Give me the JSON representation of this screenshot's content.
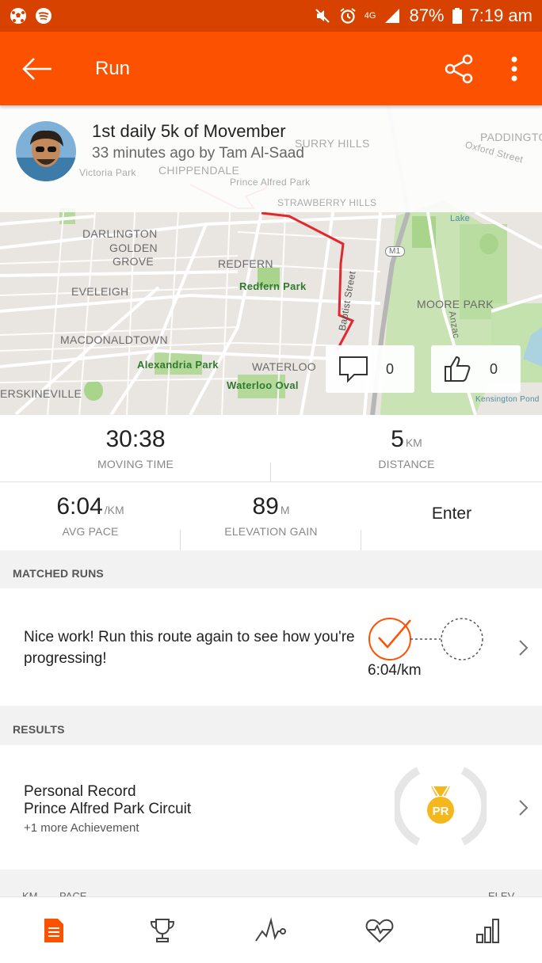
{
  "status_bar": {
    "battery": "87%",
    "time": "7:19 am",
    "network": "4G"
  },
  "app_bar": {
    "title": "Run"
  },
  "activity": {
    "title": "1st daily 5k of Movember",
    "subtitle": "33 minutes ago by Tam Al-Saad",
    "comments_count": "0",
    "kudos_count": "0"
  },
  "map": {
    "labels": [
      "DARLINGTON",
      "GOLDEN",
      "GROVE",
      "EVELEIGH",
      "REDFERN",
      "Redfern Park",
      "Baptist Street",
      "MOORE PARK",
      "MACDONALDTOWN",
      "Alexandria Park",
      "WATERLOO",
      "Waterloo Oval",
      "ERSKINEVILLE",
      "M1",
      "Anzac",
      "Kensington Pond",
      "Victoria Park",
      "CHIPPENDALE",
      "Prince Alfred Park",
      "STRAWBERRY HILLS",
      "SURRY HILLS",
      "PADDINGTON",
      "Oxford Street",
      "Lake"
    ]
  },
  "stats": {
    "moving_time": {
      "value": "30:38",
      "label": "MOVING TIME"
    },
    "distance": {
      "value": "5",
      "unit": "KM",
      "label": "DISTANCE"
    },
    "avg_pace": {
      "value": "6:04",
      "unit": "/KM",
      "label": "AVG PACE"
    },
    "elevation": {
      "value": "89",
      "unit": "M",
      "label": "ELEVATION GAIN"
    },
    "enter_label": "Enter"
  },
  "matched_runs": {
    "heading": "MATCHED RUNS",
    "text": "Nice work! Run this route again to see how you're progressing!",
    "pace": "6:04/km"
  },
  "results": {
    "heading": "RESULTS",
    "line1": "Personal Record",
    "line2": "Prince Alfred Park Circuit",
    "line3": "+1 more Achievement",
    "badge": "PR"
  },
  "splits_peek": {
    "km": "KM",
    "pace": "PACE",
    "elev": "ELEV"
  },
  "colors": {
    "accent": "#fc5200",
    "status": "#d84200",
    "gold": "#f5b81c",
    "route": "#e0282e"
  },
  "bottom_nav": [
    {
      "icon": "feed-icon",
      "active": true
    },
    {
      "icon": "trophy-icon",
      "active": false
    },
    {
      "icon": "activity-graph-icon",
      "active": false
    },
    {
      "icon": "heart-rate-icon",
      "active": false
    },
    {
      "icon": "bar-chart-icon",
      "active": false
    }
  ]
}
